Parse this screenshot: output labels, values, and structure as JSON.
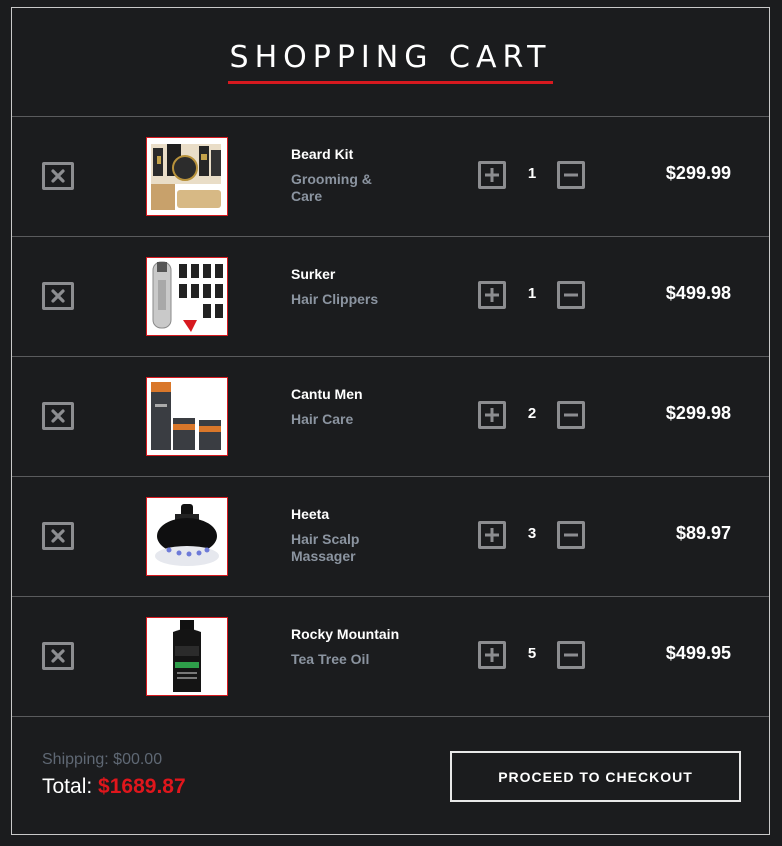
{
  "header": {
    "title": "SHOPPING CART",
    "accent_color": "#d7191f"
  },
  "items": [
    {
      "name": "Beard Kit",
      "category": "Grooming & Care",
      "quantity": "1",
      "price": "$299.99",
      "image": "beard-kit-image"
    },
    {
      "name": "Surker",
      "category": "Hair Clippers",
      "quantity": "1",
      "price": "$499.98",
      "image": "hair-clippers-image"
    },
    {
      "name": "Cantu Men",
      "category": "Hair Care",
      "quantity": "2",
      "price": "$299.98",
      "image": "hair-care-image"
    },
    {
      "name": "Heeta",
      "category": "Hair Scalp Massager",
      "quantity": "3",
      "price": "$89.97",
      "image": "scalp-massager-image"
    },
    {
      "name": "Rocky Mountain",
      "category": "Tea Tree Oil",
      "quantity": "5",
      "price": "$499.95",
      "image": "tea-tree-oil-image"
    }
  ],
  "icons": {
    "remove": "close-icon",
    "increase": "plus-icon",
    "decrease": "minus-icon"
  },
  "summary": {
    "shipping": "Shipping: $00.00",
    "total_label": "Total:",
    "total_value": "$1689.87",
    "total_color": "#e0161c"
  },
  "checkout": {
    "label": "PROCEED TO CHECKOUT"
  }
}
